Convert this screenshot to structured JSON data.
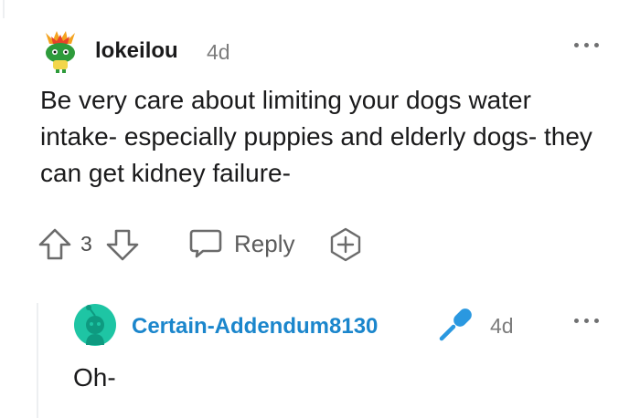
{
  "comment": {
    "author": "lokeilou",
    "age": "4d",
    "avatar_icon": "fire-snoo-avatar-icon",
    "text": "Be very care about limiting your dogs water intake- especially puppies and elderly dogs- they can get kidney failure-",
    "score": "3",
    "reply_label": "Reply",
    "icons": [
      "upvote-icon",
      "downvote-icon",
      "reply-bubble-icon",
      "award-plus-icon",
      "more-options-icon"
    ]
  },
  "reply": {
    "author": "Certain-Addendum8130",
    "age": "4d",
    "avatar_icon": "default-snoo-avatar-icon",
    "text": "Oh-",
    "flair_icon": "microphone-icon"
  },
  "colors": {
    "username_reply": "#1b86cc",
    "avatar_reply": "#1ec5a4",
    "mic_blue": "#2a98e0",
    "muted": "#7c7c7c"
  }
}
